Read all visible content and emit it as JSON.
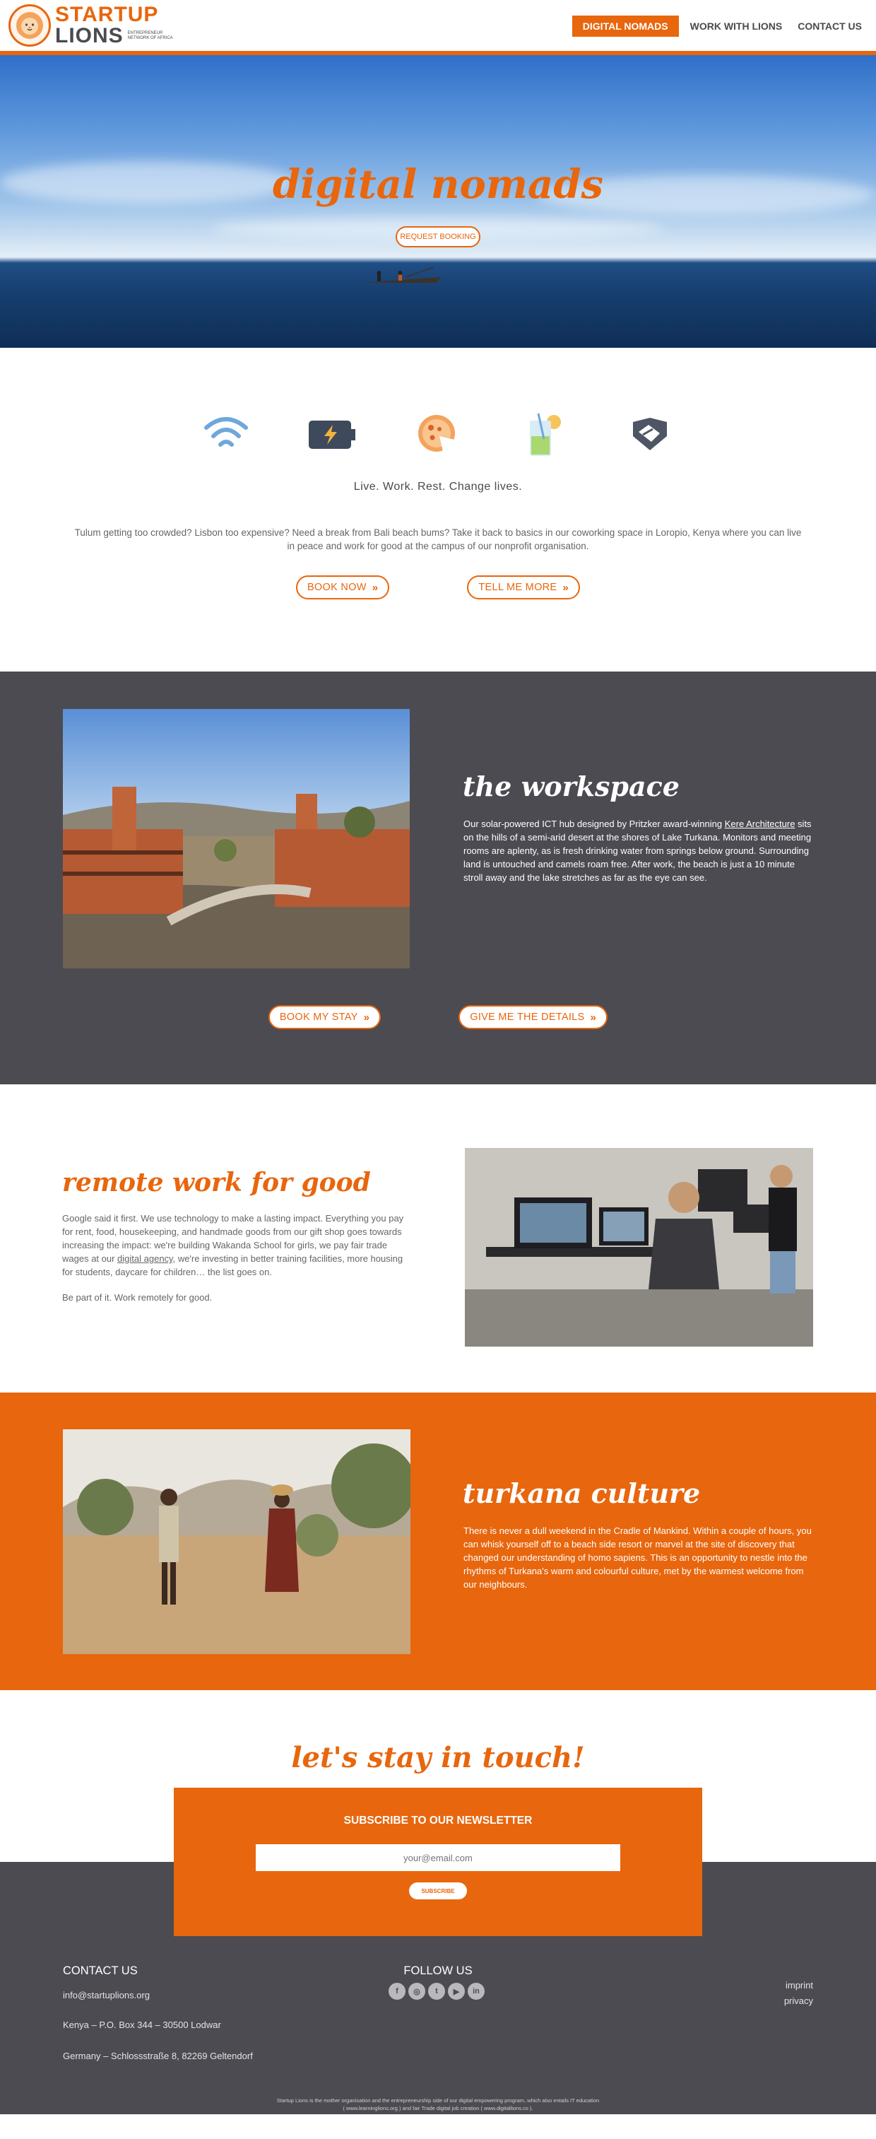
{
  "brand": {
    "name_line1": "STARTUP",
    "name_line2": "LIONS",
    "tagline": "ENTREPRENEUR NETWORK OF AFRICA",
    "orange": "#e8660d",
    "dark_gray": "#4c4b51"
  },
  "nav": {
    "items": [
      {
        "label": "DIGITAL NOMADS",
        "active": true
      },
      {
        "label": "WORK WITH LIONS",
        "active": false
      },
      {
        "label": "CONTACT US",
        "active": false
      }
    ]
  },
  "hero": {
    "title": "digital nomads",
    "button": "REQUEST BOOKING"
  },
  "intro": {
    "icons": [
      "wifi-icon",
      "battery-charging-icon",
      "food-plate-icon",
      "drink-glass-icon",
      "handshake-icon"
    ],
    "tagline": "Live. Work. Rest. Change lives.",
    "text": "Tulum getting too crowded? Lisbon too expensive? Need a break from Bali beach bums? Take it back to basics in our coworking space in Loropio, Kenya where you can live in peace and work for good at the campus of our nonprofit organisation.",
    "book_now": "BOOK NOW",
    "tell_me_more": "TELL ME MORE"
  },
  "workspace": {
    "title": "the workspace",
    "text_before": "Our solar-powered ICT hub designed by Pritzker award-winning ",
    "link": "Kere Architecture",
    "text_after": " sits on the hills of a semi-arid desert at the shores of Lake Turkana. Monitors and meeting rooms are aplenty, as is fresh drinking water from springs below ground. Surrounding land is untouched and camels roam free. After work, the beach is just a 10 minute stroll away and the lake stretches as far as the eye can see.",
    "book_my_stay": "BOOK MY STAY",
    "give_details": "GIVE ME THE DETAILS"
  },
  "remote": {
    "title": "remote work for good",
    "text_before": "Google said it first. We use technology to make a lasting impact. Everything you pay for rent, food, housekeeping, and handmade goods from our gift shop goes towards increasing the impact: we're building Wakanda School for girls, we pay fair trade wages at our ",
    "link": "digital agency",
    "text_after": ", we're investing in better training facilities, more housing for students, daycare for children… the list goes on.",
    "closing": "Be part of it. Work remotely for good."
  },
  "turkana": {
    "title": "turkana culture",
    "text": "There is never a dull weekend in the Cradle of Mankind. Within a couple of hours, you can whisk yourself off to a beach side resort or marvel at the site of discovery that changed our understanding of homo sapiens. This is an opportunity to nestle into the rhythms of Turkana's warm and colourful culture, met by the warmest welcome from our neighbours."
  },
  "newsletter": {
    "section_title": "let's stay in touch!",
    "heading": "SUBSCRIBE TO OUR NEWSLETTER",
    "placeholder": "your@email.com",
    "button": "SUBSCRIBE"
  },
  "footer": {
    "contact_heading": "CONTACT US",
    "email": "info@startuplions.org",
    "kenya": "Kenya – P.O. Box 344 – 30500 Lodwar",
    "germany": "Germany – Schlossstraße 8, 82269 Geltendorf",
    "follow_heading": "FOLLOW US",
    "social": [
      "facebook-icon",
      "instagram-icon",
      "twitter-icon",
      "youtube-icon",
      "linkedin-icon"
    ],
    "imprint": "imprint",
    "privacy": "privacy",
    "fine_line1": "Startup Lions is the mother organisation and the entrepreneurship side of our digital empowering program, which also entails IT education",
    "fine_line2": "( www.learninglions.org ) and fair Trade digital job creation ( www.digitallions.co )."
  }
}
